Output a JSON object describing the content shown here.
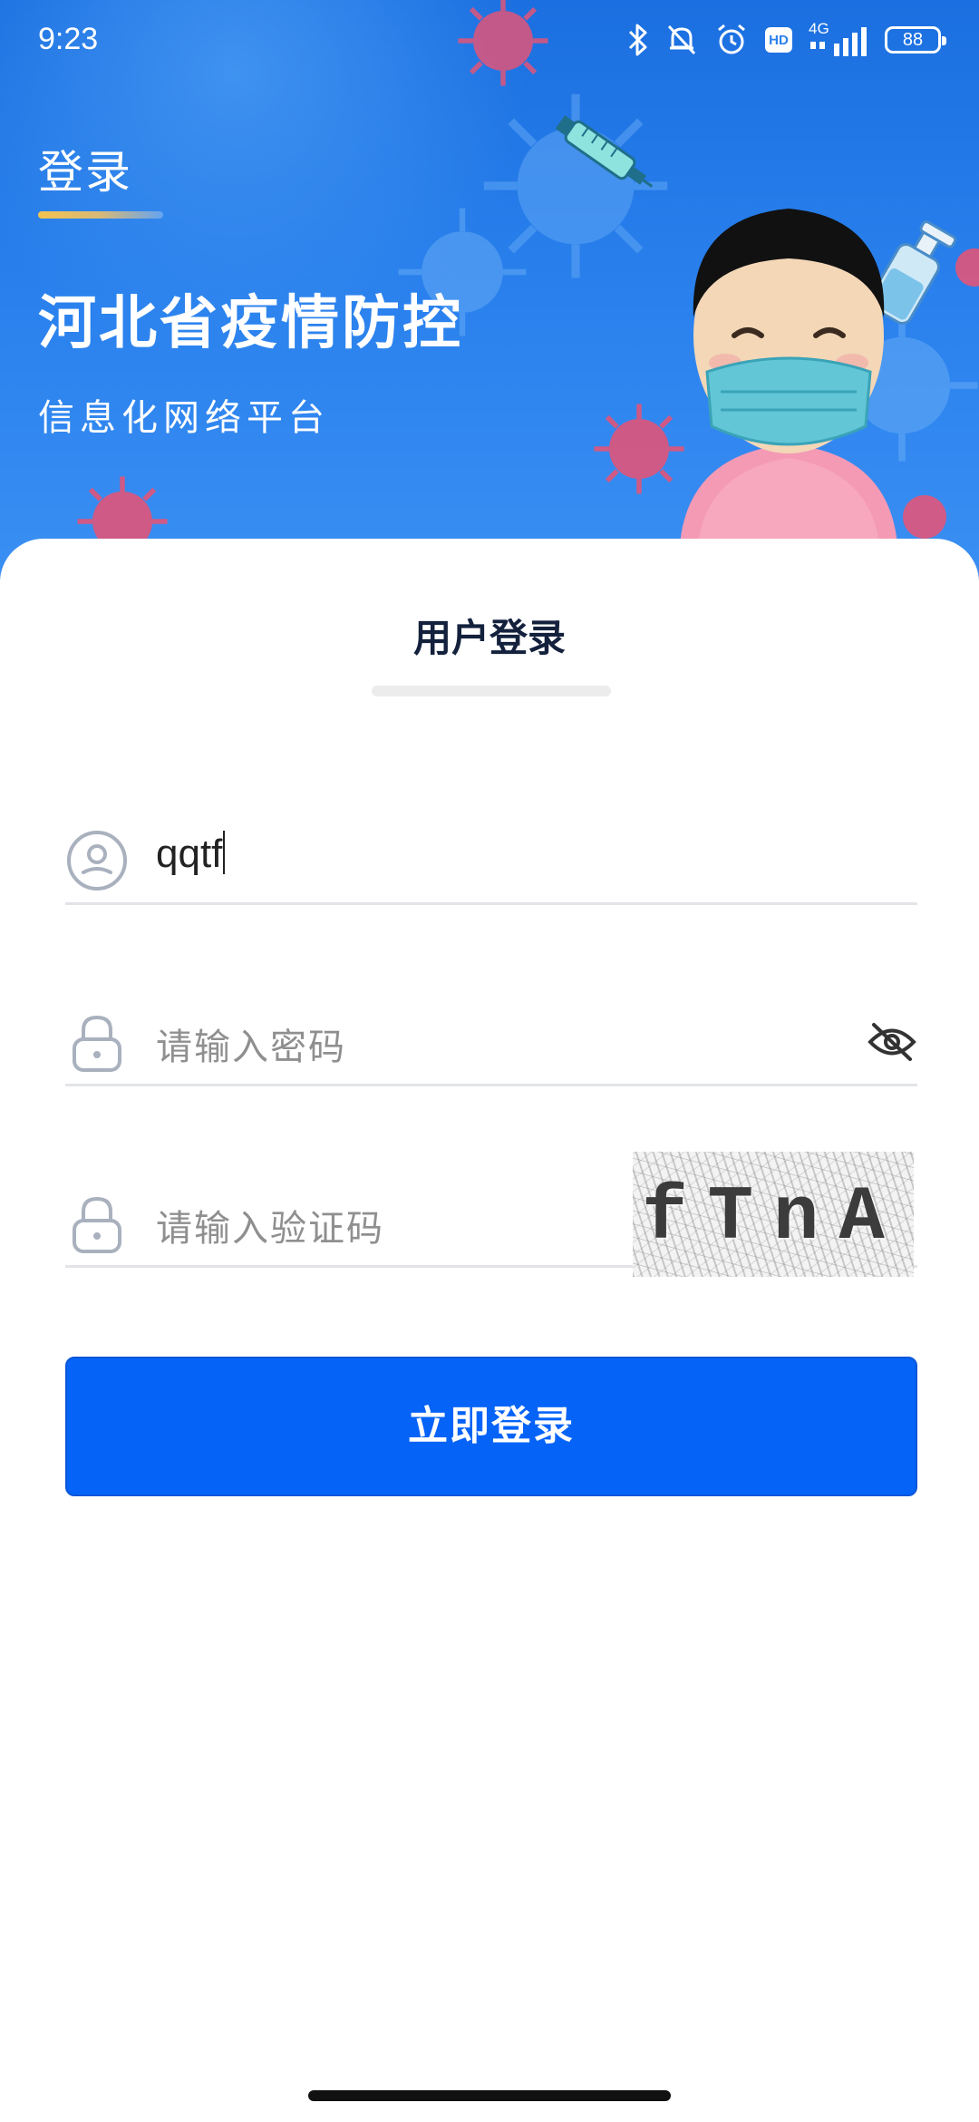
{
  "status_bar": {
    "time": "9:23",
    "network": "4G",
    "hd_label": "HD",
    "battery": "88"
  },
  "header": {
    "nav_title": "登录",
    "title": "河北省疫情防控",
    "subtitle": "信息化网络平台"
  },
  "login": {
    "card_title": "用户登录",
    "username_value": "qqtf",
    "password_placeholder": "请输入密码",
    "captcha_placeholder": "请输入验证码",
    "captcha_text": "fTnA",
    "submit_label": "立即登录"
  },
  "colors": {
    "primary": "#0563f7",
    "hero_blue": "#2b82ee",
    "title_dark": "#14213d"
  }
}
